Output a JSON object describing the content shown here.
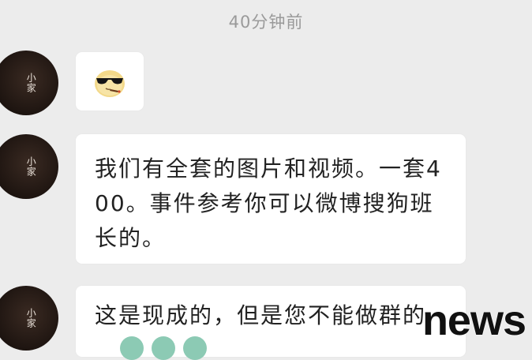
{
  "chat": {
    "timestamp": "40分钟前",
    "avatar_text": "小家",
    "messages": [
      {
        "type": "sticker",
        "sticker": "sunglasses-emoji"
      },
      {
        "type": "text",
        "text": "我们有全套的图片和视频。一套400。事件参考你可以微博搜狗班长的。"
      },
      {
        "type": "text",
        "text": "这是现成的，但是您不能做群的"
      }
    ]
  },
  "watermark": {
    "text": "news"
  },
  "colors": {
    "background": "#ececec",
    "bubble": "#ffffff",
    "text": "#222222",
    "timestamp": "#9a9a9a"
  }
}
